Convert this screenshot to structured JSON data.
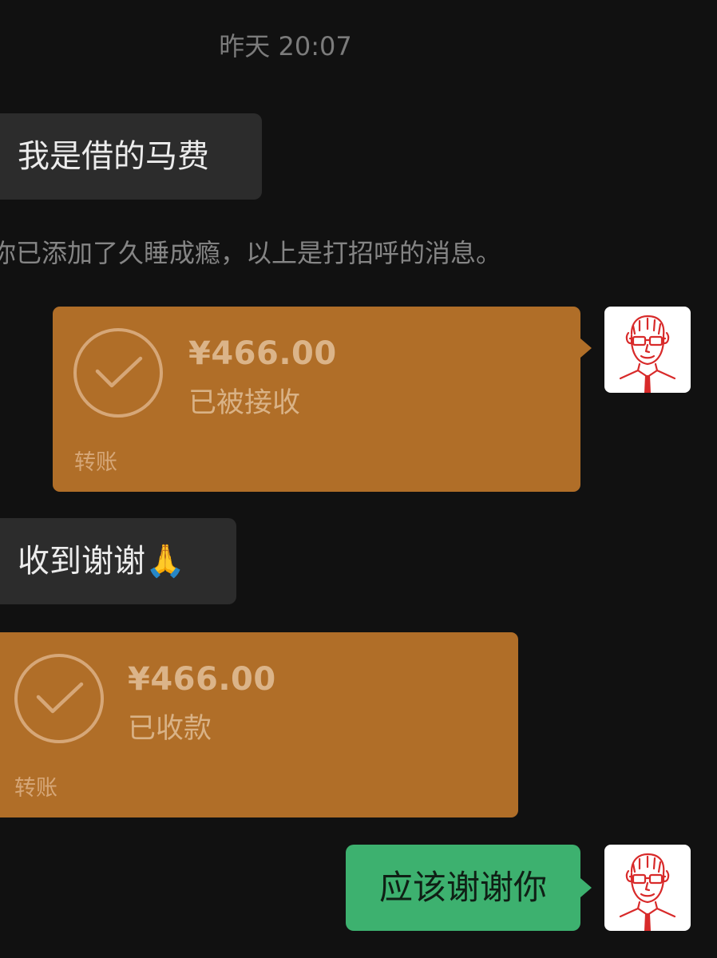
{
  "chat": {
    "timestamp": "昨天 20:07",
    "messages": [
      {
        "type": "incoming_text",
        "text": "我是借的马费"
      },
      {
        "type": "system",
        "text": "你已添加了久睡成瘾，以上是打招呼的消息。"
      },
      {
        "type": "outgoing_transfer",
        "amount": "¥466.00",
        "status": "已被接收",
        "kind": "转账"
      },
      {
        "type": "incoming_text",
        "text": "收到谢谢🙏"
      },
      {
        "type": "incoming_transfer",
        "amount": "¥466.00",
        "status": "已收款",
        "kind": "转账"
      },
      {
        "type": "outgoing_text",
        "text": "应该谢谢你"
      }
    ]
  },
  "icons": {
    "check": "check-circle-icon",
    "avatar": "cartoon-man-avatar"
  },
  "colors": {
    "background": "#111111",
    "incoming_bubble": "#2c2c2c",
    "transfer_card": "#b06e28",
    "outgoing_bubble": "#3db16f"
  }
}
